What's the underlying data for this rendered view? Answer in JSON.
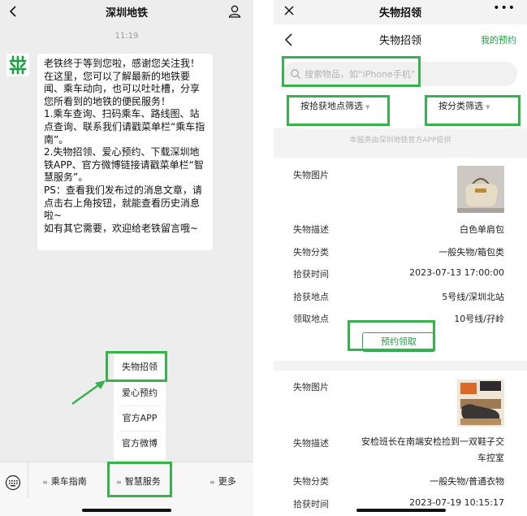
{
  "left": {
    "title": "深圳地铁",
    "timestamp": "11:19",
    "message": "老铁终于等到您啦，感谢您关注我！\n在这里，您可以了解最新的地铁要闻、乘车动向，也可以吐吐槽，分享您所看到的地铁的便民服务！\n1.乘车查询、扫码乘车、路线图、站点查询、联系我们请戳菜单栏“乘车指南”。\n2.失物招领、爱心预约、下载深圳地铁APP、官方微博链接请戳菜单栏“智慧服务”。\nPS：查看我们发布过的消息文章，请点击右上角按钮，就能查看历史消息啦~\n如有其它需要，欢迎给老铁留言哦~",
    "submenu": [
      "失物招领",
      "爱心预约",
      "官方APP",
      "官方微博"
    ],
    "menu": {
      "guide": "乘车指南",
      "smart": "智慧服务",
      "more": "更多"
    }
  },
  "right": {
    "window_title": "失物招领",
    "page_title": "失物招领",
    "my_booking": "我的预约",
    "search_placeholder": "搜索物品，如“iPhone手机”",
    "filters": {
      "location": "按拾获地点筛选",
      "category": "按分类筛选"
    },
    "notice": "本服务由深圳地铁官方APP提供",
    "labels": {
      "image": "失物图片",
      "description": "失物描述",
      "category": "失物分类",
      "found_time": "拾获时间",
      "found_place": "拾获地点",
      "claim_place": "领取地点"
    },
    "items": [
      {
        "description": "白色单肩包",
        "category": "一般失物/箱包类",
        "found_time": "2023-07-13 17:00:00",
        "found_place": "5号线/深圳北站",
        "claim_place": "10号线/孖岭",
        "claim_button": "预约领取"
      },
      {
        "description": "安检班长在南端安检捡到一双鞋子交车控室",
        "category": "一般失物/普通衣物",
        "found_time": "2023-07-19 10:15:17"
      }
    ]
  },
  "colors": {
    "highlight": "#37b24d",
    "accent_green": "#1f9e44",
    "logo_green": "#1f9e44"
  }
}
